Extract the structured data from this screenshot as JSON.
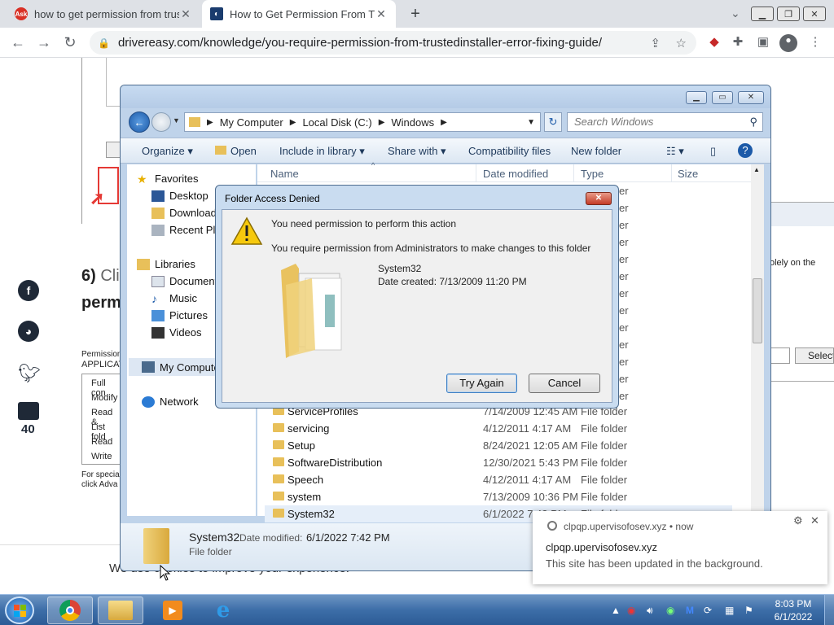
{
  "browser": {
    "tabs": [
      {
        "title": "how to get permission from trust",
        "favicon": "ask-icon"
      },
      {
        "title": "How to Get Permission From Tru",
        "favicon": "drivereasy-icon"
      }
    ],
    "url": "drivereasy.com/knowledge/you-require-permission-from-trustedinstaller-error-fixing-guide/"
  },
  "webpage": {
    "step_number": "6)",
    "step_text_partial": "Cli",
    "step_text_line2": "perm",
    "permission_label": "Permission",
    "applic_label": "APPLICAT",
    "perm_items": [
      "Full con",
      "Modify",
      "Read &",
      "List fold",
      "Read",
      "Write"
    ],
    "special_text_1": "For specia",
    "special_text_2": "click Adva",
    "right_fragment": "olely on the",
    "select_button": "Select",
    "cookie_text": "We use cookies to improve your experience.",
    "comment_count": "40"
  },
  "explorer": {
    "breadcrumb": [
      "My Computer",
      "Local Disk (C:)",
      "Windows"
    ],
    "search_placeholder": "Search Windows",
    "commands": {
      "organize": "Organize",
      "open": "Open",
      "include": "Include in library",
      "share": "Share with",
      "compat": "Compatibility files",
      "new_folder": "New folder"
    },
    "nav": {
      "favorites": "Favorites",
      "desktop": "Desktop",
      "downloads": "Downloads",
      "recent": "Recent Plac",
      "libraries": "Libraries",
      "documents": "Document",
      "music": "Music",
      "pictures": "Pictures",
      "videos": "Videos",
      "computer": "My Compute",
      "network": "Network"
    },
    "columns": {
      "name": "Name",
      "date": "Date modified",
      "type": "Type",
      "size": "Size"
    },
    "partial_type_fragment": "er",
    "files": [
      {
        "name": "ServiceProfiles",
        "date": "7/14/2009 12:45 AM",
        "type": "File folder"
      },
      {
        "name": "servicing",
        "date": "4/12/2011 4:17 AM",
        "type": "File folder"
      },
      {
        "name": "Setup",
        "date": "8/24/2021 12:05 AM",
        "type": "File folder"
      },
      {
        "name": "SoftwareDistribution",
        "date": "12/30/2021 5:43 PM",
        "type": "File folder"
      },
      {
        "name": "Speech",
        "date": "4/12/2011 4:17 AM",
        "type": "File folder"
      },
      {
        "name": "system",
        "date": "7/13/2009 10:36 PM",
        "type": "File folder"
      },
      {
        "name": "System32",
        "date": "6/1/2022 7:42 PM",
        "type": "File folder"
      }
    ],
    "details": {
      "name": "System32",
      "modified_label": "Date modified:",
      "modified_value": "6/1/2022 7:42 PM",
      "type": "File folder"
    }
  },
  "dialog": {
    "title": "Folder Access Denied",
    "heading": "You need permission to perform this action",
    "message": "You require permission from Administrators to make changes to this folder",
    "folder_name": "System32",
    "date_created": "Date created: 7/13/2009 11:20 PM",
    "try_again": "Try Again",
    "cancel": "Cancel"
  },
  "notification": {
    "source": "clpqp.upervisofosev.xyz",
    "time": "now",
    "title": "clpqp.upervisofosev.xyz",
    "body": "This site has been updated in the background."
  },
  "taskbar": {
    "time": "8:03 PM",
    "date": "6/1/2022"
  },
  "colors": {
    "accent": "#3c7fc4",
    "chrome_tabbar": "#dee1e6",
    "folder": "#e8c05a"
  }
}
